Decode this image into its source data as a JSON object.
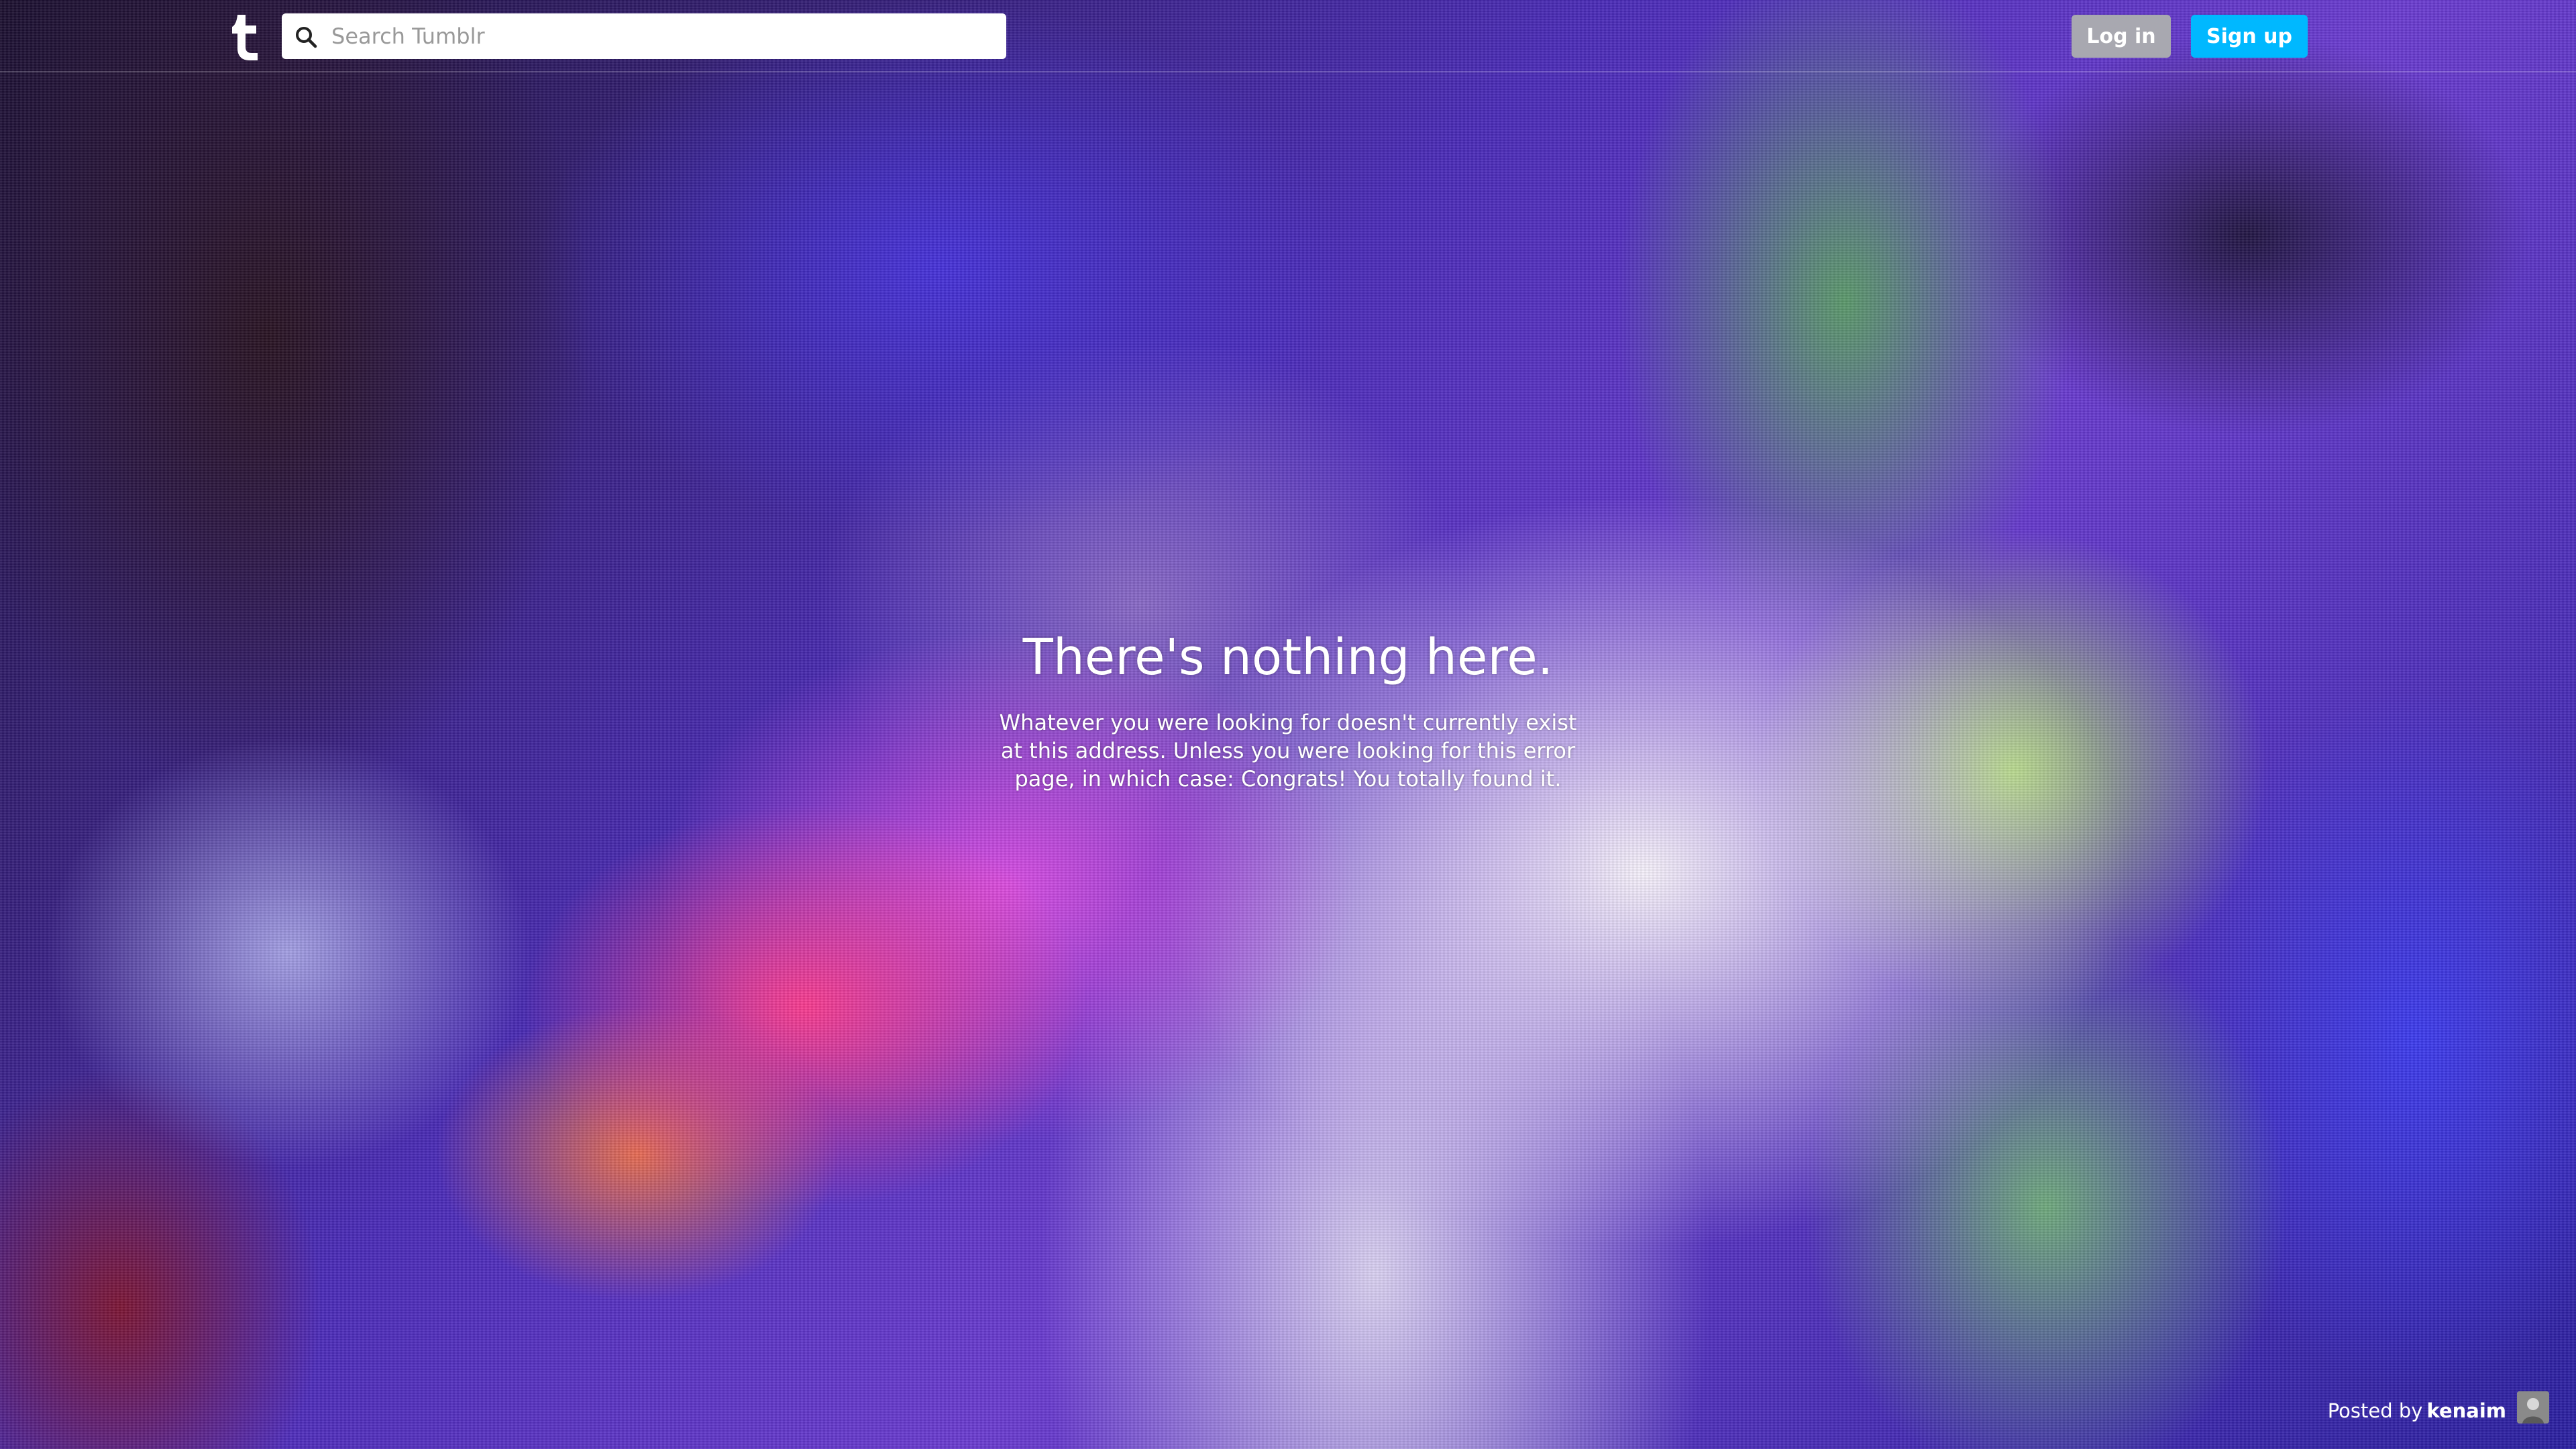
{
  "header": {
    "logo_glyph": "t",
    "search": {
      "placeholder": "Search Tumblr",
      "value": "",
      "icon": "search-icon"
    },
    "login_label": "Log in",
    "signup_label": "Sign up"
  },
  "main": {
    "title": "There's nothing here.",
    "message": "Whatever you were looking for doesn't currently exist at this address. Unless you were looking for this error page, in which case: Congrats! You totally found it."
  },
  "footer": {
    "posted_by_label": "Posted by",
    "author": "kenaim"
  },
  "colors": {
    "signup_button": "#00b8ff",
    "login_button": "#a8a8b0",
    "text": "#ffffff"
  }
}
